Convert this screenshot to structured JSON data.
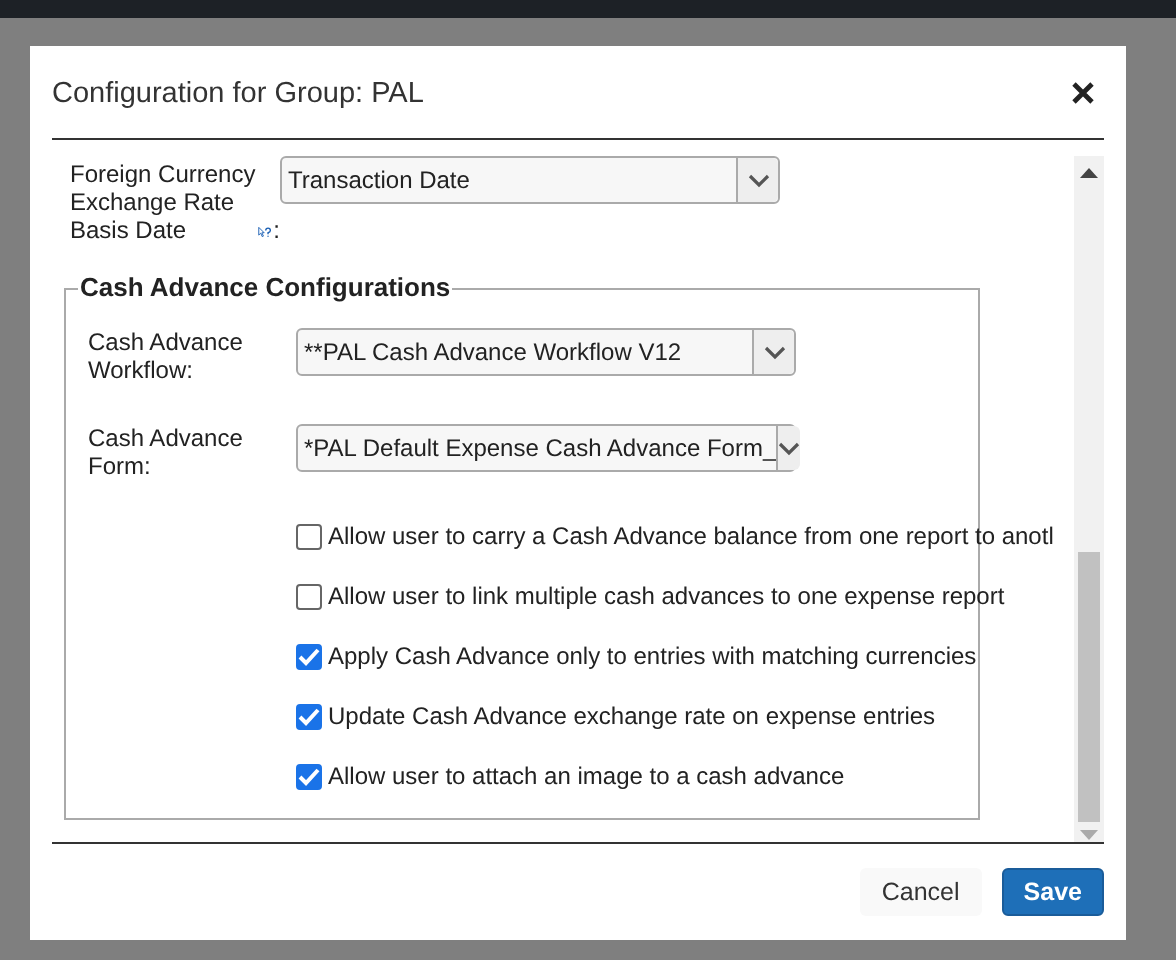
{
  "dialog": {
    "title": "Configuration for Group: PAL",
    "top_field": {
      "label_lines": [
        "Foreign Currency",
        "Exchange Rate",
        "Basis Date"
      ],
      "label_suffix": ":",
      "value": "Transaction Date"
    },
    "section": {
      "title": "Cash Advance Configurations",
      "fields": [
        {
          "label": "Cash Advance Workflow:",
          "value": "**PAL Cash Advance Workflow V12"
        },
        {
          "label": "Cash Advance Form:",
          "value": "*PAL Default Expense Cash Advance Form_"
        }
      ],
      "options": [
        {
          "label": "Allow user to carry a Cash Advance balance from one report to anotl",
          "checked": false
        },
        {
          "label": "Allow user to link multiple cash advances to one expense report",
          "checked": false
        },
        {
          "label": "Apply Cash Advance only to entries with matching currencies",
          "checked": true
        },
        {
          "label": "Update Cash Advance exchange rate on expense entries",
          "checked": true
        },
        {
          "label": "Allow user to attach an image to a cash advance",
          "checked": true
        }
      ]
    },
    "buttons": [
      {
        "label": "Cancel",
        "kind": "secondary"
      },
      {
        "label": "Save",
        "kind": "primary"
      }
    ]
  }
}
